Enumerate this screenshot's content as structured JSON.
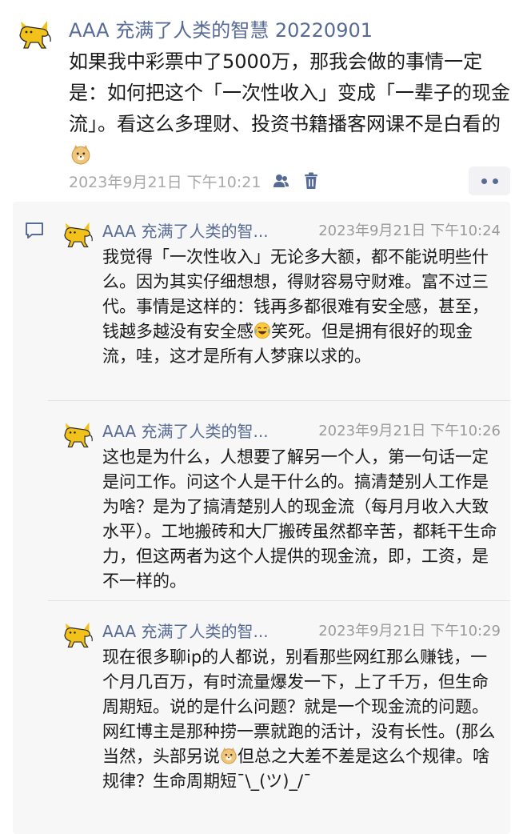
{
  "post": {
    "author": "AAA 充满了人类的智慧 20220901",
    "body": "如果我中彩票中了5000万，那我会做的事情一定是：如何把这个「一次性收入」变成「一辈子的现金流」。看这么多理财、投资书籍播客网课不是白看的",
    "timestamp": "2023年9月21日 下午10:21",
    "icons": [
      "doge-emoji",
      "people-icon",
      "trash-icon",
      "more-icon"
    ]
  },
  "comments": [
    {
      "author": "AAA 充满了人类的智...",
      "timestamp": "2023年9月21日 下午10:24",
      "text_before": "我觉得「一次性收入」无论多大额，都不能说明些什么。因为其实仔细想想，得财容易守财难。富不过三代。事情是这样的：钱再多都很难有安全感，甚至，钱越多越没有安全感",
      "text_after": "笑死。但是拥有很好的现金流，哇，这才是所有人梦寐以求的。",
      "emoji": "laughing-crying-emoji"
    },
    {
      "author": "AAA 充满了人类的智...",
      "timestamp": "2023年9月21日 下午10:26",
      "text_before": "这也是为什么，人想要了解另一个人，第一句话一定是问工作。问这个人是干什么的。搞清楚别人工作是为啥？是为了搞清楚别人的现金流（每月月收入大致水平）。工地搬砖和大厂搬砖虽然都辛苦，都耗干生命力，但这两者为这个人提供的现金流，即，工资，是不一样的。",
      "text_after": "",
      "emoji": ""
    },
    {
      "author": "AAA 充满了人类的智...",
      "timestamp": "2023年9月21日 下午10:29",
      "text_before": "现在很多聊ip的人都说，别看那些网红那么赚钱，一个月几百万，有时流量爆发一下，上了千万，但生命周期短。说的是什么问题？就是一个现金流的问题。网红博主是那种捞一票就跑的活计，没有长性。(那么当然，头部另说",
      "text_after": "但总之大差不差是这么个规律。啥规律？生命周期短¯\\_(ツ)_/¯",
      "emoji": "doge-emoji"
    }
  ],
  "colors": {
    "link_blue": "#576b95",
    "meta_gray": "#a8a8a8",
    "panel_bg": "#f7f7f7"
  }
}
